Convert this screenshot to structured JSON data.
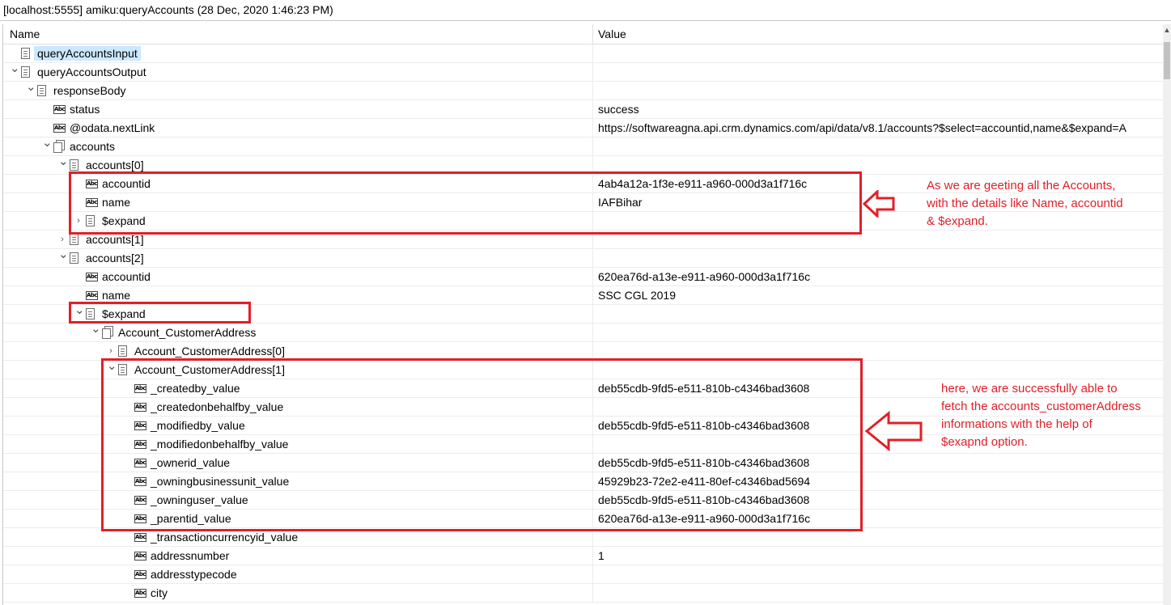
{
  "window": {
    "title": "[localhost:5555] amiku:queryAccounts (28 Dec, 2020 1:46:23 PM)"
  },
  "columns": {
    "name": "Name",
    "value": "Value"
  },
  "rows": [
    {
      "label": "queryAccountsInput",
      "value": "",
      "icon": "doc",
      "twisty": "",
      "selected": true
    },
    {
      "label": "queryAccountsOutput",
      "value": "",
      "icon": "doc",
      "twisty": "expanded"
    },
    {
      "label": "responseBody",
      "value": "",
      "icon": "doc",
      "twisty": "expanded"
    },
    {
      "label": "status",
      "value": "success",
      "icon": "abc",
      "twisty": ""
    },
    {
      "label": "@odata.nextLink",
      "value": "https://softwareagna.api.crm.dynamics.com/api/data/v8.1/accounts?$select=accountid,name&$expand=A",
      "icon": "abc",
      "twisty": ""
    },
    {
      "label": "accounts",
      "value": "",
      "icon": "docs",
      "twisty": "expanded"
    },
    {
      "label": "accounts[0]",
      "value": "",
      "icon": "doc",
      "twisty": "expanded"
    },
    {
      "label": "accountid",
      "value": "4ab4a12a-1f3e-e911-a960-000d3a1f716c",
      "icon": "abc",
      "twisty": ""
    },
    {
      "label": "name",
      "value": "IAFBihar",
      "icon": "abc",
      "twisty": ""
    },
    {
      "label": "$expand",
      "value": "",
      "icon": "doc",
      "twisty": "collapsed"
    },
    {
      "label": "accounts[1]",
      "value": "",
      "icon": "doc",
      "twisty": "collapsed"
    },
    {
      "label": "accounts[2]",
      "value": "",
      "icon": "doc",
      "twisty": "expanded"
    },
    {
      "label": "accountid",
      "value": "620ea76d-a13e-e911-a960-000d3a1f716c",
      "icon": "abc",
      "twisty": ""
    },
    {
      "label": "name",
      "value": "SSC CGL 2019",
      "icon": "abc",
      "twisty": ""
    },
    {
      "label": "$expand",
      "value": "",
      "icon": "doc",
      "twisty": "expanded"
    },
    {
      "label": "Account_CustomerAddress",
      "value": "",
      "icon": "docs",
      "twisty": "expanded"
    },
    {
      "label": "Account_CustomerAddress[0]",
      "value": "",
      "icon": "doc",
      "twisty": "collapsed"
    },
    {
      "label": "Account_CustomerAddress[1]",
      "value": "",
      "icon": "doc",
      "twisty": "expanded"
    },
    {
      "label": "_createdby_value",
      "value": "deb55cdb-9fd5-e511-810b-c4346bad3608",
      "icon": "abc",
      "twisty": ""
    },
    {
      "label": "_createdonbehalfby_value",
      "value": "",
      "icon": "abc",
      "twisty": ""
    },
    {
      "label": "_modifiedby_value",
      "value": "deb55cdb-9fd5-e511-810b-c4346bad3608",
      "icon": "abc",
      "twisty": ""
    },
    {
      "label": "_modifiedonbehalfby_value",
      "value": "",
      "icon": "abc",
      "twisty": ""
    },
    {
      "label": "_ownerid_value",
      "value": "deb55cdb-9fd5-e511-810b-c4346bad3608",
      "icon": "abc",
      "twisty": ""
    },
    {
      "label": "_owningbusinessunit_value",
      "value": "45929b23-72e2-e411-80ef-c4346bad5694",
      "icon": "abc",
      "twisty": ""
    },
    {
      "label": "_owninguser_value",
      "value": "deb55cdb-9fd5-e511-810b-c4346bad3608",
      "icon": "abc",
      "twisty": ""
    },
    {
      "label": "_parentid_value",
      "value": "620ea76d-a13e-e911-a960-000d3a1f716c",
      "icon": "abc",
      "twisty": ""
    },
    {
      "label": "_transactioncurrencyid_value",
      "value": "",
      "icon": "abc",
      "twisty": ""
    },
    {
      "label": "addressnumber",
      "value": "1",
      "icon": "abc",
      "twisty": ""
    },
    {
      "label": "addresstypecode",
      "value": "",
      "icon": "abc",
      "twisty": ""
    },
    {
      "label": "city",
      "value": "",
      "icon": "abc",
      "twisty": ""
    }
  ],
  "icons": {
    "abc_text": "Abc"
  },
  "annotations": {
    "note1": [
      "As we are geeting all the Accounts,",
      "with the details like Name, accountid",
      "& $expand."
    ],
    "note2": [
      "here, we are successfully able to",
      "fetch the accounts_customerAddress",
      "informations with the help of",
      "$exapnd option."
    ],
    "color": "#e02028"
  }
}
